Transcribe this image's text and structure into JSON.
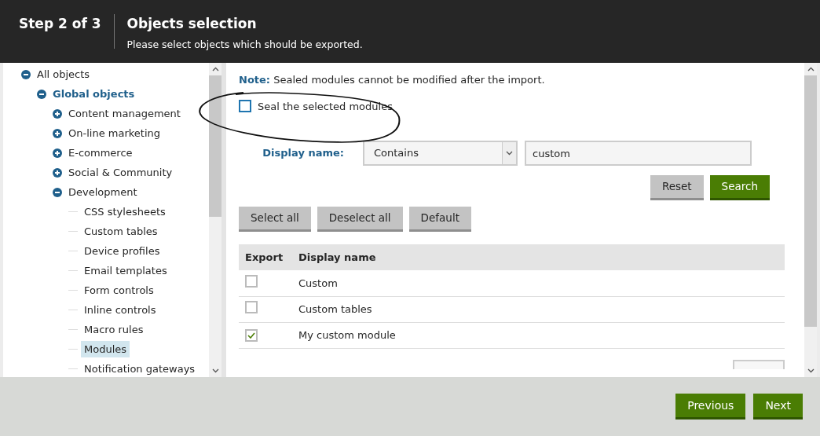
{
  "header": {
    "step": "Step 2 of 3",
    "title": "Objects selection",
    "subtitle": "Please select objects which should be exported."
  },
  "tree": [
    {
      "label": "All objects",
      "expanded": true,
      "emphasized": false,
      "selected": false,
      "children": [
        {
          "label": "Global objects",
          "expanded": true,
          "emphasized": true,
          "selected": false,
          "children": [
            {
              "label": "Content management",
              "expanded": false,
              "emphasized": false,
              "selected": false
            },
            {
              "label": "On-line marketing",
              "expanded": false,
              "emphasized": false,
              "selected": false
            },
            {
              "label": "E-commerce",
              "expanded": false,
              "emphasized": false,
              "selected": false
            },
            {
              "label": "Social & Community",
              "expanded": false,
              "emphasized": false,
              "selected": false
            },
            {
              "label": "Development",
              "expanded": true,
              "emphasized": false,
              "selected": false,
              "children": [
                {
                  "label": "CSS stylesheets",
                  "emphasized": false,
                  "selected": false
                },
                {
                  "label": "Custom tables",
                  "emphasized": false,
                  "selected": false
                },
                {
                  "label": "Device profiles",
                  "emphasized": false,
                  "selected": false
                },
                {
                  "label": "Email templates",
                  "emphasized": false,
                  "selected": false
                },
                {
                  "label": "Form controls",
                  "emphasized": false,
                  "selected": false
                },
                {
                  "label": "Inline controls",
                  "emphasized": false,
                  "selected": false
                },
                {
                  "label": "Macro rules",
                  "emphasized": false,
                  "selected": false
                },
                {
                  "label": "Modules",
                  "emphasized": false,
                  "selected": true
                },
                {
                  "label": "Notification gateways",
                  "emphasized": false,
                  "selected": false
                }
              ]
            }
          ]
        }
      ]
    }
  ],
  "note": {
    "text": "**Note:** Sealed modules cannot be modified after the import."
  },
  "seal": {
    "label": "Seal the selected modules",
    "checked": false
  },
  "filter": {
    "label": "Display name:",
    "operator": "Contains",
    "value": "custom"
  },
  "filter_buttons": [
    {
      "label": "Reset",
      "kind": "secondary"
    },
    {
      "label": "Search",
      "kind": "primary"
    }
  ],
  "selection_buttons": [
    "Select all",
    "Deselect all",
    "Default"
  ],
  "table": {
    "columns": [
      "Export",
      "Display name"
    ],
    "rows": [
      {
        "name": "Custom",
        "checked": false
      },
      {
        "name": "Custom tables",
        "checked": false
      },
      {
        "name": "My custom module",
        "checked": true
      }
    ]
  },
  "footer_buttons": [
    "Previous",
    "Next"
  ]
}
